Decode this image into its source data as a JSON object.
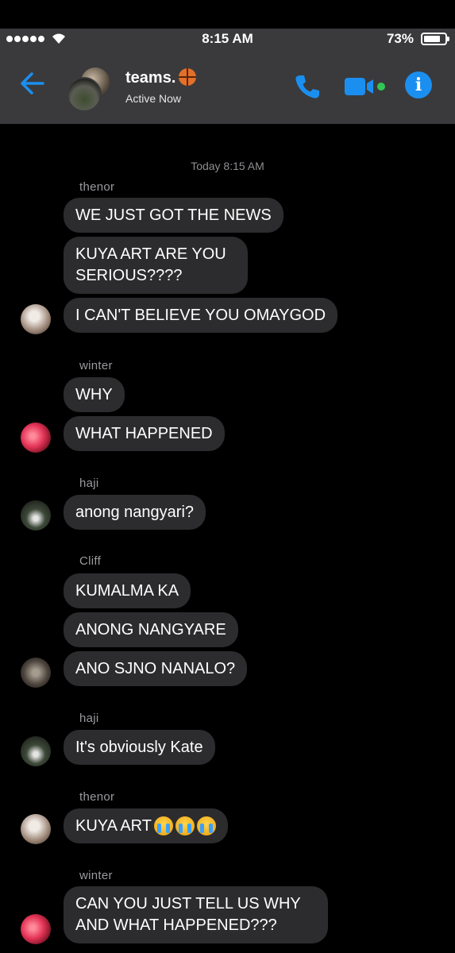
{
  "status_bar": {
    "time": "8:15 AM",
    "battery": "73%"
  },
  "header": {
    "title": "teams.",
    "subtitle": "Active Now"
  },
  "chat": {
    "timestamp": "Today 8:15 AM",
    "senders": {
      "thenor_1": "thenor",
      "winter_1": "winter",
      "haji_1": "haji",
      "cliff_1": "Cliff",
      "haji_2": "haji",
      "thenor_2": "thenor",
      "winter_2": "winter"
    },
    "messages": {
      "m1": "WE JUST GOT THE NEWS",
      "m2": "KUYA ART ARE YOU SERIOUS????",
      "m3": "I CAN'T BELIEVE YOU OMAYGOD",
      "m4": "WHY",
      "m5": "WHAT HAPPENED",
      "m6": "anong nangyari?",
      "m7": "KUMALMA KA",
      "m8": "ANONG NANGYARE",
      "m9": "ANO SJNO NANALO?",
      "m10": "It's obviously Kate",
      "m11": "KUYA ART",
      "m12": "CAN YOU JUST TELL US WHY AND WHAT HAPPENED???"
    }
  },
  "icons": {
    "back": "arrow-left-icon",
    "phone": "phone-icon",
    "video": "video-camera-icon",
    "info": "info-icon",
    "emoji": "loudly-crying-face-emoji"
  },
  "colors": {
    "accent": "#1b8ff0",
    "header_bg": "#3a3a3c",
    "bubble_bg": "#2c2c2e",
    "active_dot": "#31c755"
  }
}
